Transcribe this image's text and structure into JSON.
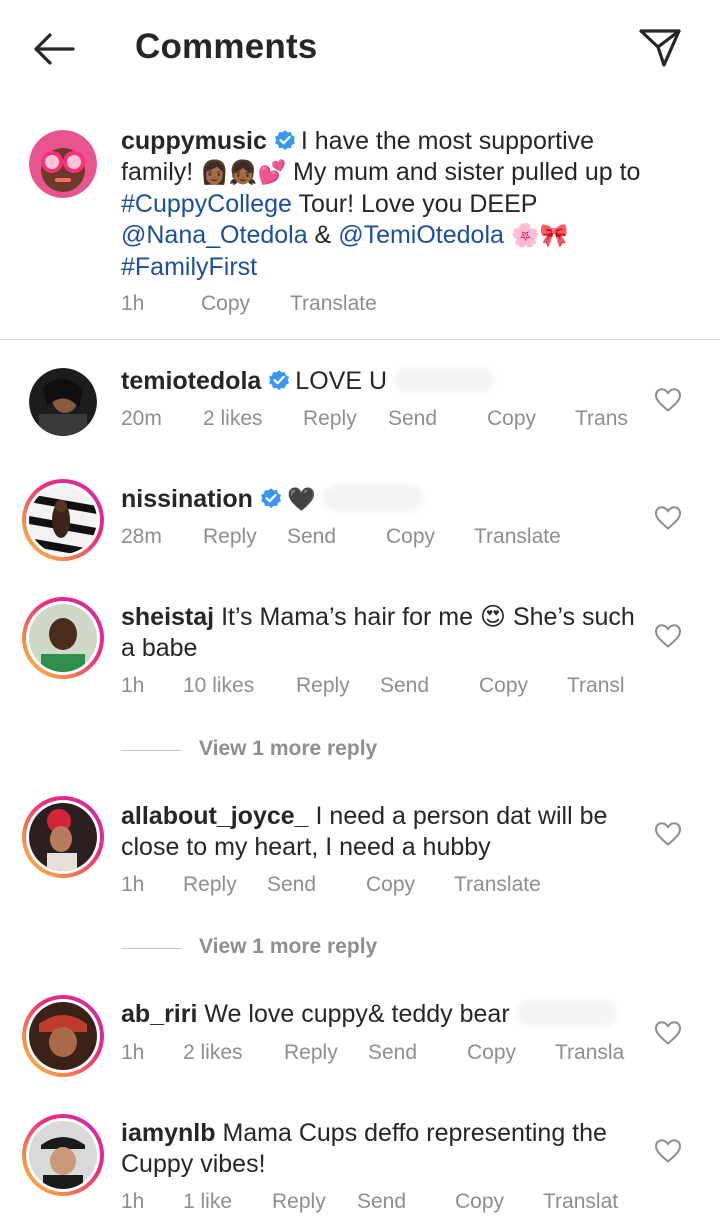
{
  "header": {
    "title": "Comments"
  },
  "caption": {
    "username": "cuppymusic",
    "text_1": "I have the most supportive family! ",
    "emoji_1": "👩🏾‍👧🏾💕",
    "text_2": " My mum and sister pulled up to ",
    "hashtag_1": "#CuppyCollege",
    "text_3": " Tour! Love you DEEP ",
    "mention_1": "@Nana_Otedola",
    "text_4": " & ",
    "mention_2": "@TemiOtedola",
    "emoji_2": " 🌸🎀",
    "hashtag_2": "#FamilyFirst",
    "time": "1h",
    "copy": "Copy",
    "translate": "Translate"
  },
  "comments": [
    {
      "username": "temiotedola",
      "verified": true,
      "text": "LOVE U",
      "time": "20m",
      "likes": "2 likes",
      "reply": "Reply",
      "send": "Send",
      "copy": "Copy",
      "translate": "Trans"
    },
    {
      "username": "nissination",
      "verified": true,
      "text": "🖤",
      "time": "28m",
      "likes": "",
      "reply": "Reply",
      "send": "Send",
      "copy": "Copy",
      "translate": "Translate"
    },
    {
      "username": "sheistaj",
      "verified": false,
      "text": "It’s Mama’s hair for me 😍 She’s such a babe",
      "time": "1h",
      "likes": "10 likes",
      "reply": "Reply",
      "send": "Send",
      "copy": "Copy",
      "translate": "Transl",
      "view_more": "View 1 more reply"
    },
    {
      "username": "allabout_joyce_",
      "verified": false,
      "text": "I need a person dat will be close to my heart, I need a hubby",
      "time": "1h",
      "likes": "",
      "reply": "Reply",
      "send": "Send",
      "copy": "Copy",
      "translate": "Translate",
      "view_more": "View 1 more reply"
    },
    {
      "username": "ab_riri",
      "verified": false,
      "text": "We love cuppy& teddy bear",
      "time": "1h",
      "likes": "2 likes",
      "reply": "Reply",
      "send": "Send",
      "copy": "Copy",
      "translate": "Transla"
    },
    {
      "username": "iamynlb",
      "verified": false,
      "text": "Mama Cups deffo representing the Cuppy vibes!",
      "time": "1h",
      "likes": "1 like",
      "reply": "Reply",
      "send": "Send",
      "copy": "Copy",
      "translate": "Translat"
    }
  ],
  "colors": {
    "link": "#1a4f9c",
    "verified": "#3897f0",
    "meta": "#8e8e8e",
    "text": "#262626"
  }
}
